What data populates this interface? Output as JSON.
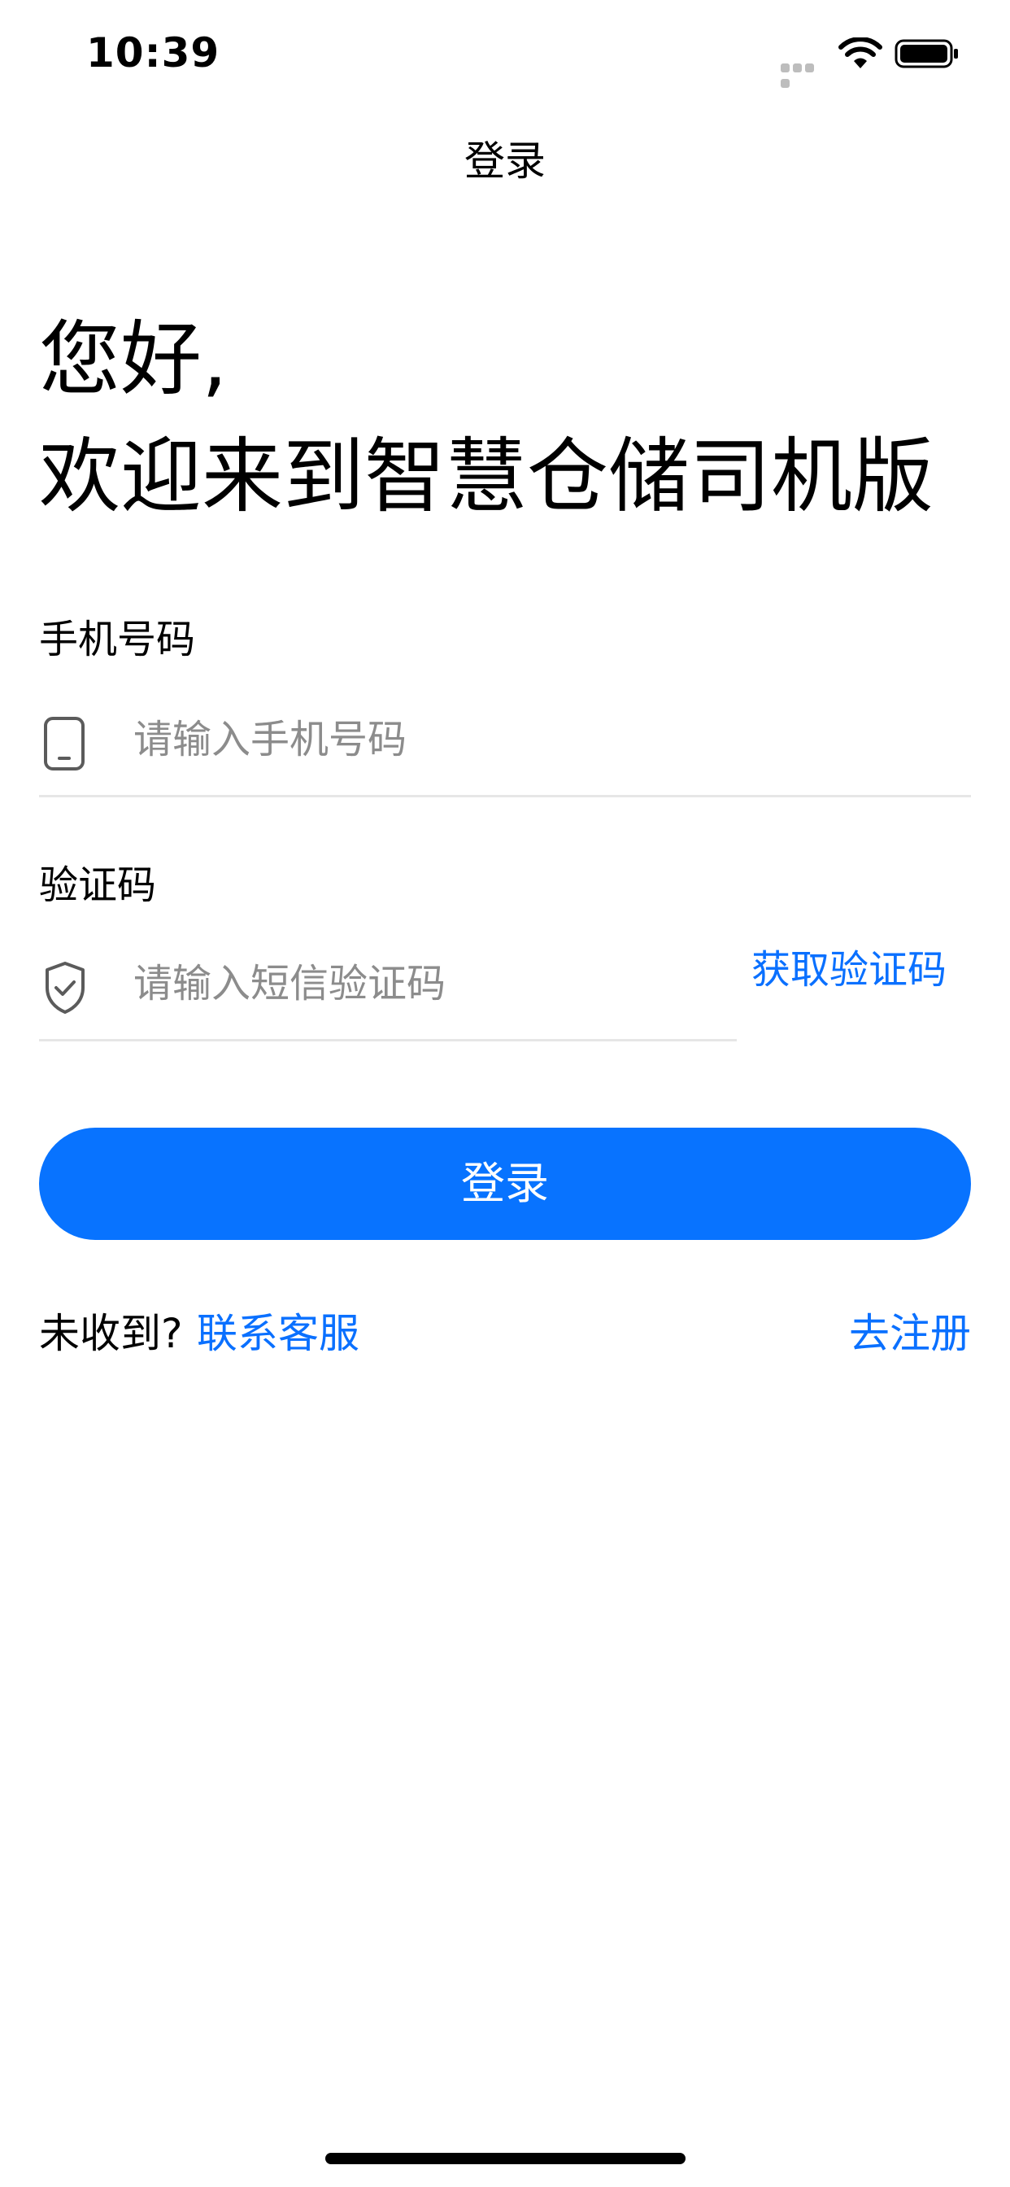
{
  "status_bar": {
    "time": "10:39"
  },
  "nav": {
    "title": "登录"
  },
  "greeting": {
    "line1": "您好,",
    "line2": "欢迎来到智慧仓储司机版"
  },
  "phone": {
    "label": "手机号码",
    "placeholder": "请输入手机号码",
    "value": "",
    "icon": "phone-icon"
  },
  "code": {
    "label": "验证码",
    "placeholder": "请输入短信验证码",
    "value": "",
    "icon": "shield-check-icon",
    "get_code_label": "获取验证码"
  },
  "login_button": {
    "label": "登录"
  },
  "footer": {
    "not_received": "未收到?",
    "contact_label": "联系客服",
    "register_label": "去注册"
  },
  "colors": {
    "accent": "#0873FF",
    "link": "#0A70FF",
    "placeholder": "#8C8C8C",
    "divider": "#E6E6E6"
  }
}
